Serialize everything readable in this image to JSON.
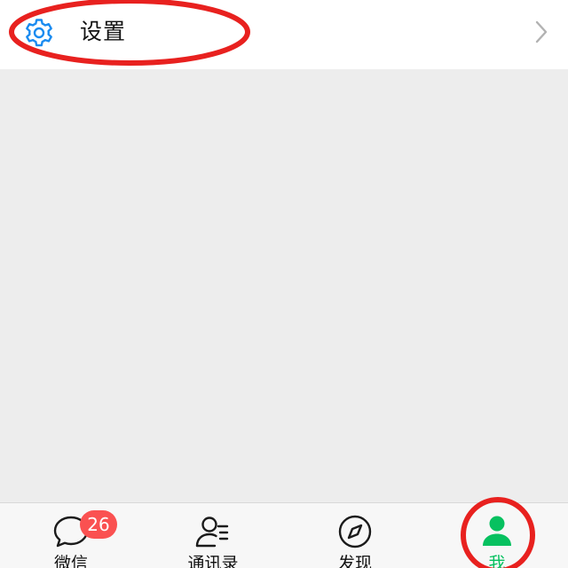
{
  "settings": {
    "label": "设置",
    "icon": "gear-icon",
    "chevron_icon": "chevron-right-icon",
    "icon_color": "#1a8bf0"
  },
  "tab_bar": {
    "active_color": "#07c160",
    "badge_color": "#fa5151",
    "tabs": [
      {
        "label": "微信",
        "icon": "chat-bubble-icon",
        "badge": "26",
        "active": false
      },
      {
        "label": "通讯录",
        "icon": "contacts-icon",
        "active": false
      },
      {
        "label": "发现",
        "icon": "compass-icon",
        "active": false
      },
      {
        "label": "我",
        "icon": "person-icon",
        "active": true
      }
    ]
  },
  "annotations": {
    "color": "#e8211f"
  }
}
